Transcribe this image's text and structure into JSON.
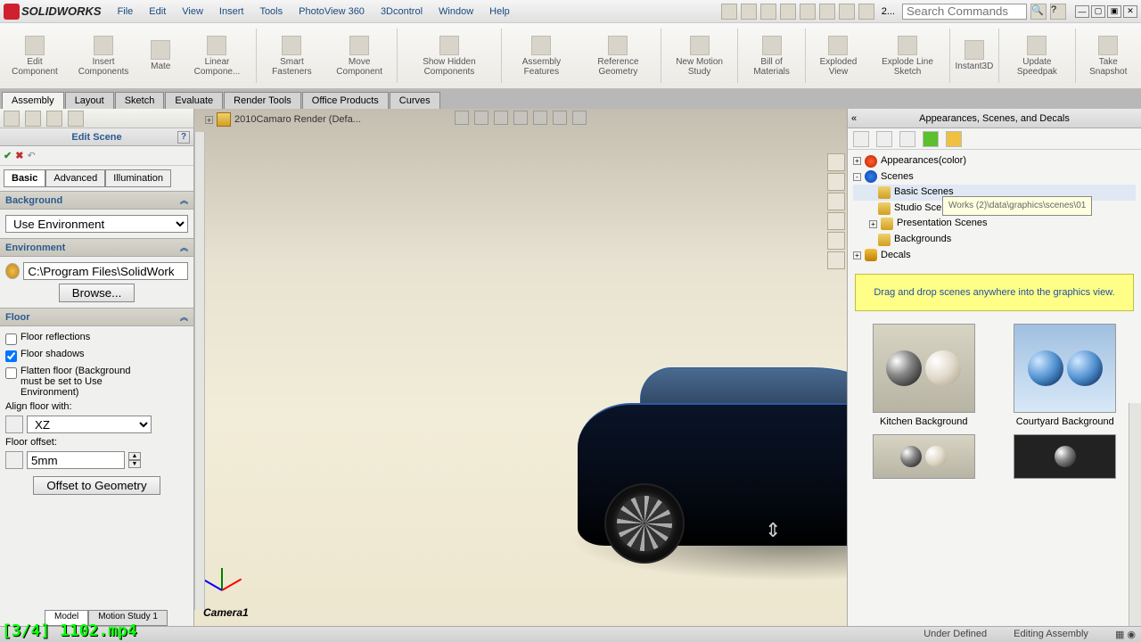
{
  "app": {
    "name": "SOLIDWORKS"
  },
  "menus": [
    "File",
    "Edit",
    "View",
    "Insert",
    "Tools",
    "PhotoView 360",
    "3Dcontrol",
    "Window",
    "Help"
  ],
  "search_placeholder": "Search Commands",
  "quick_more": "2...",
  "ribbon": [
    "Edit Component",
    "Insert Components",
    "Mate",
    "Linear Compone...",
    "Smart Fasteners",
    "Move Component",
    "Show Hidden Components",
    "Assembly Features",
    "Reference Geometry",
    "New Motion Study",
    "Bill of Materials",
    "Exploded View",
    "Explode Line Sketch",
    "Instant3D",
    "Update Speedpak",
    "Take Snapshot"
  ],
  "model_tabs": [
    "Assembly",
    "Layout",
    "Sketch",
    "Evaluate",
    "Render Tools",
    "Office Products",
    "Curves"
  ],
  "active_model_tab": "Assembly",
  "viewport": {
    "doc_label": "2010Camaro Render  (Defa...",
    "camera_label": "Camera1"
  },
  "edit_scene": {
    "title": "Edit Scene",
    "subtabs": [
      "Basic",
      "Advanced",
      "Illumination"
    ],
    "active_subtab": "Basic",
    "background": {
      "header": "Background",
      "mode": "Use Environment"
    },
    "environment": {
      "header": "Environment",
      "path": "C:\\Program Files\\SolidWork",
      "browse": "Browse..."
    },
    "floor": {
      "header": "Floor",
      "reflections_label": "Floor reflections",
      "reflections_checked": false,
      "shadows_label": "Floor shadows",
      "shadows_checked": true,
      "flatten_label": "Flatten floor (Background must be set to Use Environment)",
      "flatten_checked": false,
      "align_label": "Align floor with:",
      "align_value": "XZ",
      "offset_label": "Floor offset:",
      "offset_value": "5mm",
      "offset_btn": "Offset to Geometry"
    }
  },
  "right": {
    "title": "Appearances, Scenes, and Decals",
    "tree": {
      "appearances": "Appearances(color)",
      "scenes": "Scenes",
      "basic": "Basic Scenes",
      "studio": "Studio Scenes",
      "presentation": "Presentation Scenes",
      "backgrounds": "Backgrounds",
      "decals": "Decals"
    },
    "tooltip": "Works (2)\\data\\graphics\\scenes\\01",
    "hint": "Drag and drop scenes anywhere into the graphics view.",
    "thumbs": [
      "Kitchen Background",
      "Courtyard Background"
    ]
  },
  "bottom_tabs": [
    "Model",
    "Motion Study 1"
  ],
  "status": {
    "under": "Under Defined",
    "mode": "Editing Assembly"
  },
  "overlay": "[3/4] 1102.mp4"
}
